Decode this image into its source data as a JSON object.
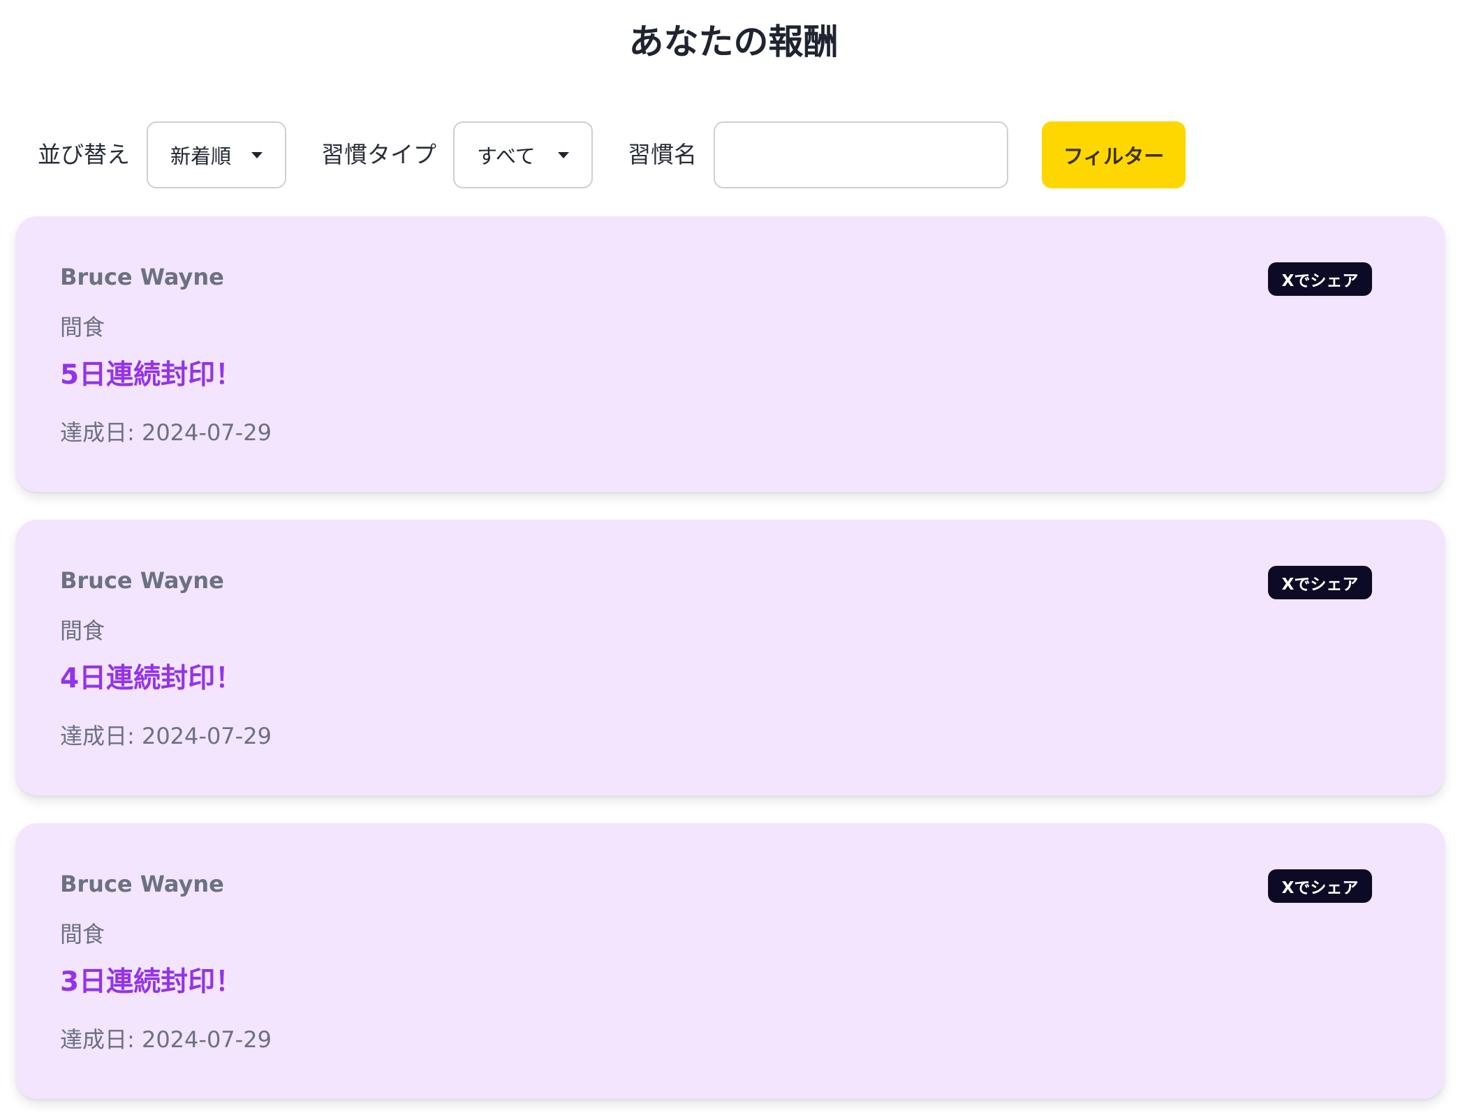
{
  "header": {
    "title": "あなたの報酬"
  },
  "filters": {
    "sort_label": "並び替え",
    "sort_value": "新着順",
    "habit_type_label": "習慣タイプ",
    "habit_type_value": "すべて",
    "habit_name_label": "習慣名",
    "habit_name_value": "",
    "filter_button_label": "フィルター"
  },
  "rewards": [
    {
      "user": "Bruce Wayne",
      "habit": "間食",
      "reward": "5日連続封印！",
      "date_label": "達成日: 2024-07-29",
      "share_label": "Xでシェア"
    },
    {
      "user": "Bruce Wayne",
      "habit": "間食",
      "reward": "4日連続封印！",
      "date_label": "達成日: 2024-07-29",
      "share_label": "Xでシェア"
    },
    {
      "user": "Bruce Wayne",
      "habit": "間食",
      "reward": "3日連続封印！",
      "date_label": "達成日: 2024-07-29",
      "share_label": "Xでシェア"
    }
  ],
  "colors": {
    "card_background": "#f3e5fd",
    "reward_accent": "#9333ea",
    "filter_button": "#ffd700",
    "share_button": "#0c0a24"
  }
}
